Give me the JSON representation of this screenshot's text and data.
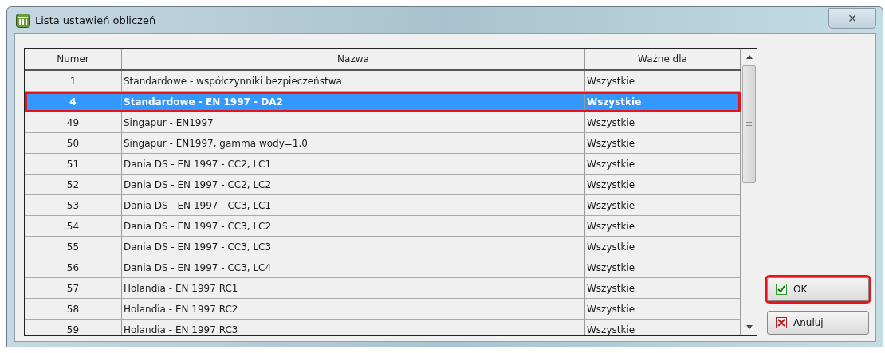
{
  "window": {
    "title": "Lista ustawień obliczeń",
    "close": "✕"
  },
  "table": {
    "columns": [
      "Numer",
      "Nazwa",
      "Ważne dla"
    ],
    "rows": [
      {
        "cells": [
          "1",
          "Standardowe - współczynniki bezpieczeństwa",
          "Wszystkie"
        ],
        "selected": false,
        "highlighted": false
      },
      {
        "cells": [
          "4",
          "Standardowe - EN 1997 - DA2",
          "Wszystkie"
        ],
        "selected": true,
        "highlighted": true
      },
      {
        "cells": [
          "49",
          "Singapur -  EN1997",
          "Wszystkie"
        ],
        "selected": false,
        "highlighted": false
      },
      {
        "cells": [
          "50",
          "Singapur -  EN1997, gamma wody=1.0",
          "Wszystkie"
        ],
        "selected": false,
        "highlighted": false
      },
      {
        "cells": [
          "51",
          "Dania DS - EN 1997 - CC2, LC1",
          "Wszystkie"
        ],
        "selected": false,
        "highlighted": false
      },
      {
        "cells": [
          "52",
          "Dania DS - EN 1997 - CC2, LC2",
          "Wszystkie"
        ],
        "selected": false,
        "highlighted": false
      },
      {
        "cells": [
          "53",
          "Dania DS - EN 1997 - CC3, LC1",
          "Wszystkie"
        ],
        "selected": false,
        "highlighted": false
      },
      {
        "cells": [
          "54",
          "Dania DS - EN 1997 - CC3, LC2",
          "Wszystkie"
        ],
        "selected": false,
        "highlighted": false
      },
      {
        "cells": [
          "55",
          "Dania DS - EN 1997 - CC3, LC3",
          "Wszystkie"
        ],
        "selected": false,
        "highlighted": false
      },
      {
        "cells": [
          "56",
          "Dania DS - EN 1997 - CC3, LC4",
          "Wszystkie"
        ],
        "selected": false,
        "highlighted": false
      },
      {
        "cells": [
          "57",
          "Holandia - EN 1997  RC1",
          "Wszystkie"
        ],
        "selected": false,
        "highlighted": false
      },
      {
        "cells": [
          "58",
          "Holandia - EN 1997  RC2",
          "Wszystkie"
        ],
        "selected": false,
        "highlighted": false
      },
      {
        "cells": [
          "59",
          "Holandia - EN 1997  RC3",
          "Wszystkie"
        ],
        "selected": false,
        "highlighted": false
      }
    ]
  },
  "buttons": [
    {
      "kind": "ok",
      "label": "OK",
      "highlighted": true
    },
    {
      "kind": "cancel",
      "label": "Anuluj",
      "highlighted": false
    }
  ]
}
